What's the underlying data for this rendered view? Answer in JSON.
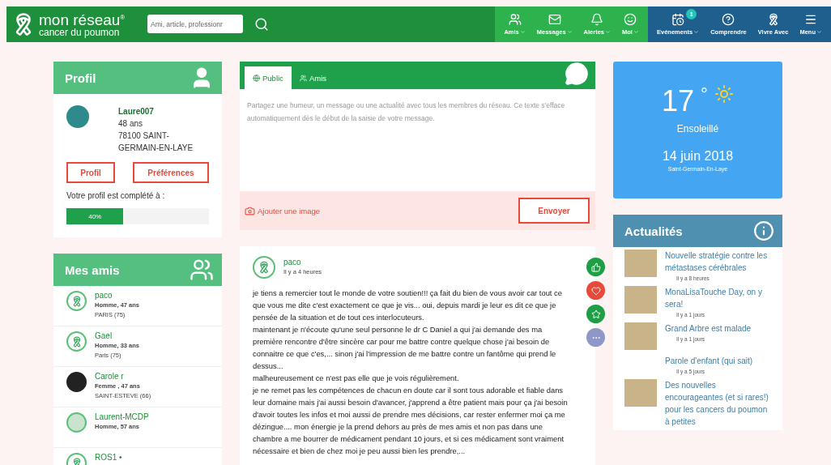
{
  "header": {
    "logo_title": "mon réseau$^{®}$",
    "logo_subtitle": "cancer du poumon",
    "search": {
      "placeholder": "Ami, article, professionr"
    },
    "social_nav": [
      {
        "label": "Amis",
        "kind": "friends",
        "caret": true
      },
      {
        "label": "Messages",
        "kind": "mail",
        "caret": true
      },
      {
        "label": "Alertes",
        "kind": "bell",
        "caret": true
      },
      {
        "label": "Moi",
        "kind": "smile",
        "caret": true
      }
    ],
    "info_nav": [
      {
        "label": "Evénements",
        "kind": "calendar",
        "caret": true,
        "badge": "1"
      },
      {
        "label": "Comprendre",
        "kind": "question",
        "caret": false
      },
      {
        "label": "Vivre Avec",
        "kind": "ribbon",
        "caret": false
      },
      {
        "label": "Menu",
        "kind": "menu",
        "caret": true
      }
    ]
  },
  "profile": {
    "title": "Profil",
    "username": "Laure007",
    "age": "48 ans",
    "location": "78100 SAINT-GERMAIN-EN-LAYE",
    "buttons": [
      "Profil",
      "Préférences"
    ],
    "completion_label": "Votre profil est complété à :",
    "completion": {
      "level": 0.4,
      "reading": "40%"
    }
  },
  "friends": {
    "title": "Mes amis",
    "items": [
      {
        "name": "paco",
        "info": "Homme, 47 ans",
        "place": "PARIS (75)",
        "kind": "ribbon"
      },
      {
        "name": "Gael",
        "info": "Homme, 33 ans",
        "place": "Paris (75)",
        "kind": "ribbon"
      },
      {
        "name": "Carole r",
        "info": "Femme , 47 ans",
        "place": "SAINT-ESTEVE (66)",
        "kind": "photo"
      },
      {
        "name": "Laurent-MCDP",
        "info": "Homme, 57 ans",
        "kind": "lungs"
      },
      {
        "name": "ROS1 •",
        "kind": "ribbon"
      }
    ]
  },
  "composer": {
    "tabs": [
      {
        "label": "Public",
        "kind": "globe",
        "selected": true
      },
      {
        "label": "Amis",
        "kind": "friends",
        "selected": false
      }
    ],
    "placeholder": "Partagez une humeur, un message ou une actualité avec tous les membres du réseau. Ce texte s'efface automatiquement dès le début de la saisie de votre message.",
    "add_image": "Ajouter une image",
    "send": "Envoyer"
  },
  "post": {
    "author": "paco",
    "time": "Il y a 4 heures",
    "paragraphs": [
      "je tiens a remercier tout le monde de votre soutien!!! ça fait du bien de vous avoir car tout ce que vous me dite c'est exactement ce que je vis... oui, depuis mardi je leur es dit ce que je pensée de la situation et de tout ces interlocuteurs.",
      "maintenant je n'écoute qu'une seul personne le dr C Daniel a qui j'ai demande des ma première rencontre d'être sincère car pour me battre contre quelque chose j'ai besoin de connaitre ce que c'es,... sinon j'ai l'impression de me battre contre un fantôme qui prend le dessus...",
      "malheureusement ce n'est pas elle que je vois régulièrement.",
      "je ne remet pas les compétences de chacun en doute car il sont tous adorable et fiable dans leur domaine mais j'ai aussi besoin d'avancer, j'apprend a être patient mais pour ça j'ai besoin d'avoir toutes les infos et moi aussi de prendre mes décisions, car rester enfermer moi ça me dézingue.... mon énergie je la prend dehors au près de mes amis et non pas dans une chambre a me bourrer de médicament pendant 10 jours, et si ces médicament sont vraiment nécessaire et bien de chez moi je peu aussi bien les prendre,..."
    ],
    "reactions": [
      {
        "kind": "like",
        "color": "#1e9e45"
      },
      {
        "kind": "heart",
        "color": "#e8493a"
      },
      {
        "kind": "star",
        "color": "#1e9e45"
      },
      {
        "kind": "more",
        "color": "#8e97c8"
      }
    ]
  },
  "weather": {
    "temperature": "17",
    "degree": "°",
    "condition": "Ensoleillé",
    "date": "14 juin 2018",
    "city": "Saint-Germain-En-Laye"
  },
  "news": {
    "title": "Actualités",
    "items": [
      {
        "title": "Nouvelle stratégie contre les métastases cérébrales",
        "time": "Il y a 8 heures",
        "image": true
      },
      {
        "title": "MonaLisaTouche Day, on y sera!",
        "time": "Il y a 1 jours",
        "image": true
      },
      {
        "title": "Grand Arbre est malade",
        "time": "Il y a 1 jours",
        "image": true
      },
      {
        "title": "Parole d'enfant (qui sait)",
        "time": "Il y a 5 jours",
        "image": false
      },
      {
        "title": "Des nouvelles encourageantes (et si rares!) pour les cancers du poumon à petites",
        "image": true
      }
    ]
  }
}
